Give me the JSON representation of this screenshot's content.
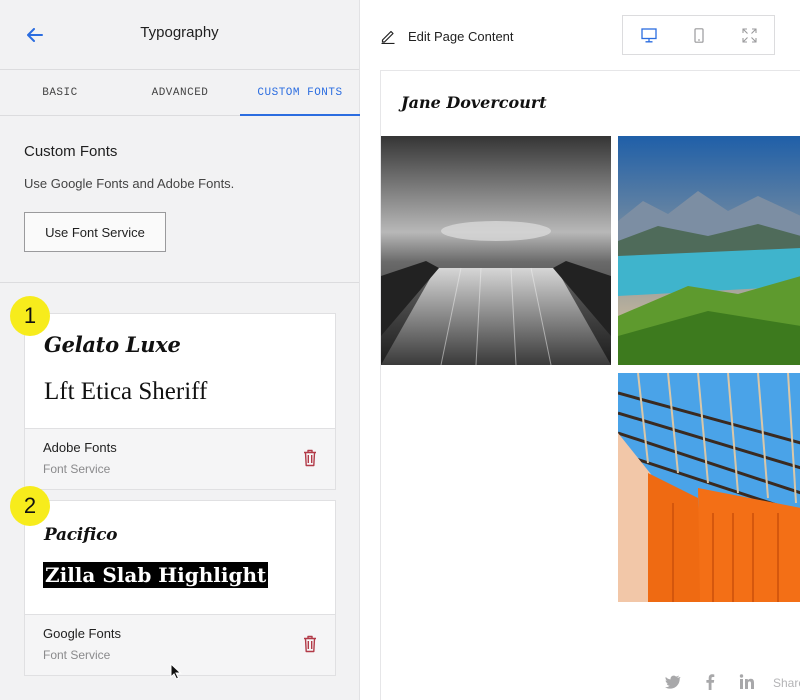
{
  "sidebar": {
    "title": "Typography",
    "tabs": [
      {
        "label": "BASIC"
      },
      {
        "label": "ADVANCED"
      },
      {
        "label": "CUSTOM FONTS"
      }
    ],
    "custom_fonts": {
      "heading": "Custom Fonts",
      "description": "Use Google Fonts and Adobe Fonts.",
      "button_label": "Use Font Service"
    },
    "font_cards": [
      {
        "badge": "1",
        "display_font": "Gelato Luxe",
        "sample_font": "Lft Etica Sheriff",
        "provider": "Adobe Fonts",
        "provider_type": "Font Service"
      },
      {
        "badge": "2",
        "display_font": "Pacifico",
        "sample_font": "Zilla Slab Highlight",
        "provider": "Google Fonts",
        "provider_type": "Font Service"
      }
    ]
  },
  "editor": {
    "edit_label": "Edit Page Content",
    "site_title": "Jane Dovercourt",
    "share_label": "Share",
    "icons": [
      "pencil-icon",
      "desktop-icon",
      "mobile-icon",
      "fullscreen-icon",
      "twitter-icon",
      "facebook-icon",
      "linkedin-icon",
      "trash-icon",
      "back-arrow-icon"
    ]
  },
  "colors": {
    "accent": "#2b6de0",
    "badge": "#f7ec1c",
    "delete": "#b23a48",
    "sidebar_bg": "#f2f2f3"
  }
}
